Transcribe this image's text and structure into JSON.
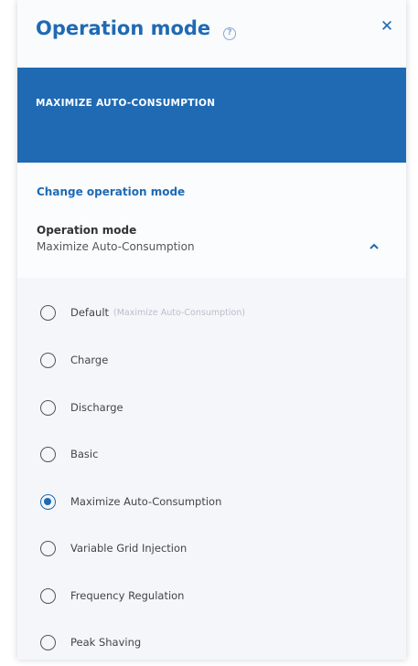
{
  "dialog": {
    "title": "Operation mode",
    "help_icon": "question-circle-icon",
    "close_icon": "close-icon",
    "close_glyph": "✕",
    "banner": "MAXIMIZE AUTO-CONSUMPTION",
    "change_link": "Change operation mode",
    "field_label": "Operation mode",
    "field_value": "Maximize Auto-Consumption",
    "chevron_icon": "chevron-up-icon"
  },
  "options": [
    {
      "label": "Default",
      "hint": "(Maximize Auto-Consumption)",
      "selected": false
    },
    {
      "label": "Charge",
      "selected": false
    },
    {
      "label": "Discharge",
      "selected": false
    },
    {
      "label": "Basic",
      "selected": false
    },
    {
      "label": "Maximize Auto-Consumption",
      "selected": true
    },
    {
      "label": "Variable Grid Injection",
      "selected": false
    },
    {
      "label": "Frequency Regulation",
      "selected": false
    },
    {
      "label": "Peak Shaving",
      "selected": false
    }
  ],
  "colors": {
    "accent": "#1f6ab3",
    "panel_bg": "#fbfcfe",
    "options_bg": "#f4f6fa"
  }
}
